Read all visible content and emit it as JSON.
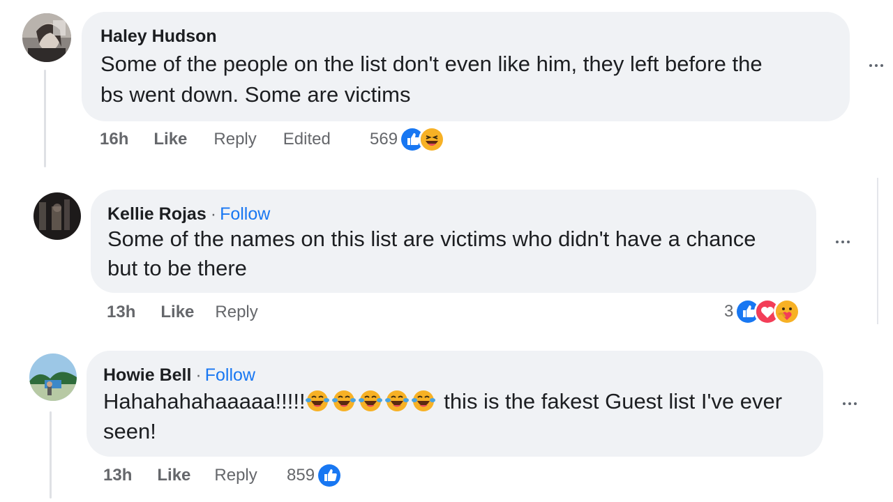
{
  "comments": [
    {
      "author": "Haley Hudson",
      "text_line1": "Some of the people on the list don't even like him, they left before the",
      "text_line2": "bs went down. Some are victims",
      "time": "16h",
      "like_label": "Like",
      "reply_label": "Reply",
      "edited_label": "Edited",
      "reaction_count": "569",
      "reactions": [
        "like-icon",
        "laugh-icon"
      ]
    },
    {
      "author": "Kellie Rojas",
      "separator": "·",
      "follow_label": "Follow",
      "text_line1": "Some of the names on this list are victims who didn't have a chance",
      "text_line2": "but to be there",
      "time": "13h",
      "like_label": "Like",
      "reply_label": "Reply",
      "reaction_count": "3",
      "reactions": [
        "like-icon",
        "love-icon",
        "care-icon"
      ]
    },
    {
      "author": "Howie Bell",
      "separator": "·",
      "follow_label": "Follow",
      "text_prefix": "Hahahahahaaaaa!!!!!",
      "text_suffix": " this is the fakest Guest list I've ever",
      "text_line2": "seen!",
      "inline_emojis": [
        "tears-of-joy-icon",
        "tears-of-joy-icon",
        "tears-of-joy-icon",
        "tears-of-joy-icon",
        "tears-of-joy-icon"
      ],
      "time": "13h",
      "like_label": "Like",
      "reply_label": "Reply",
      "reaction_count": "859",
      "reactions": [
        "like-icon"
      ]
    }
  ],
  "colors": {
    "bubble": "#f0f2f5",
    "link_blue": "#1877f2",
    "meta_gray": "#65676b",
    "love_red": "#f33e58",
    "emoji_yellow": "#f7b125"
  }
}
